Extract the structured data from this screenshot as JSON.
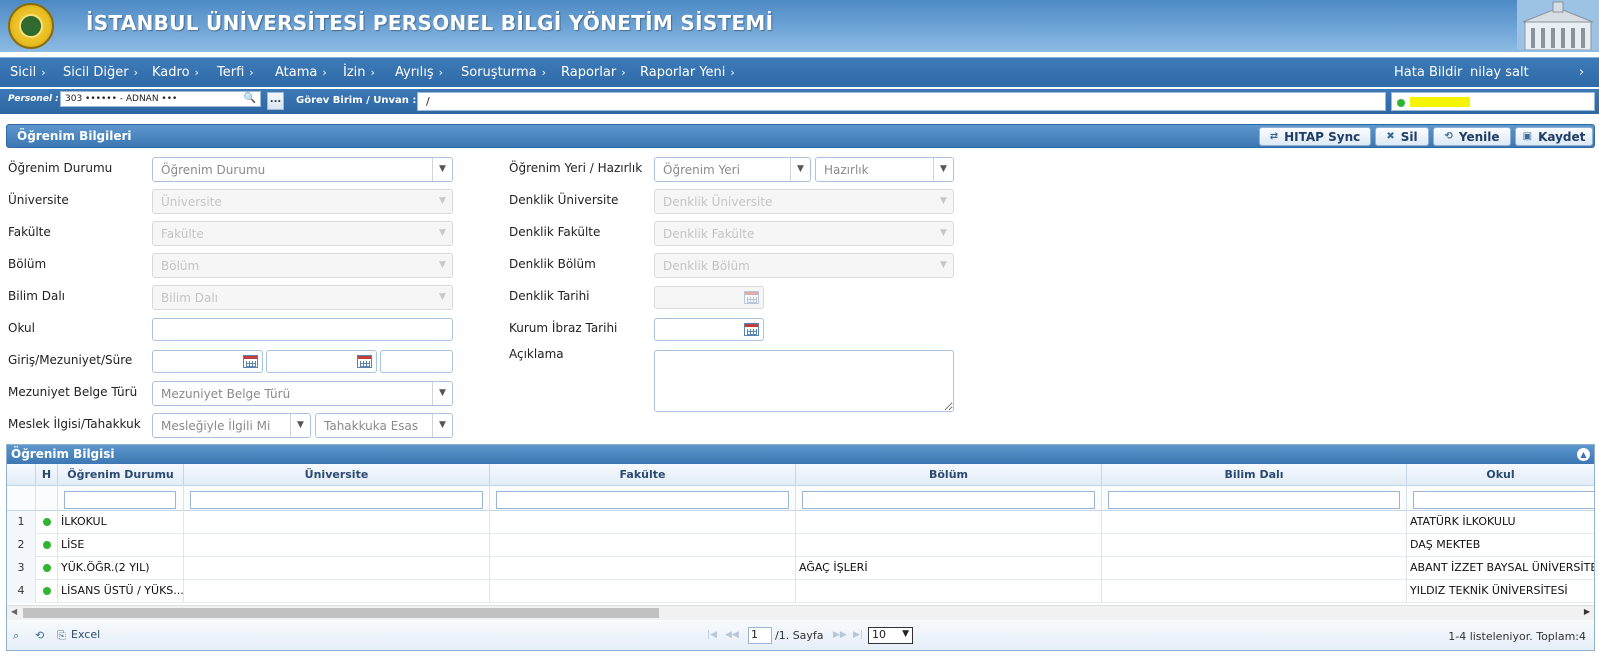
{
  "header": {
    "title": "İSTANBUL ÜNİVERSİTESİ PERSONEL BİLGİ YÖNETİM SİSTEMİ"
  },
  "menu": {
    "items": [
      "Sicil",
      "Sicil Diğer",
      "Kadro",
      "Terfi",
      "Atama",
      "İzin",
      "Ayrılış",
      "Soruşturma",
      "Raporlar",
      "Raporlar Yeni"
    ],
    "report_error": "Hata Bildir",
    "user": "nilay salt"
  },
  "personel_bar": {
    "label": "Personel :",
    "value": "303 ••••••    - ADNAN •••",
    "dots_button": "...",
    "gorev_label": "Görev Birim / Unvan :",
    "gorev_value": "/"
  },
  "section": {
    "title": "Öğrenim Bilgileri",
    "buttons": {
      "hitap": "HITAP Sync",
      "delete": "Sil",
      "refresh": "Yenile",
      "save": "Kaydet"
    }
  },
  "form": {
    "left": {
      "ogrenim_durumu": {
        "label": "Öğrenim Durumu",
        "placeholder": "Öğrenim Durumu"
      },
      "universite": {
        "label": "Üniversite",
        "placeholder": "Üniversite"
      },
      "fakulte": {
        "label": "Fakülte",
        "placeholder": "Fakülte"
      },
      "bolum": {
        "label": "Bölüm",
        "placeholder": "Bölüm"
      },
      "bilim_dali": {
        "label": "Bilim Dalı",
        "placeholder": "Bilim Dalı"
      },
      "okul": {
        "label": "Okul",
        "value": ""
      },
      "giris": {
        "label": "Giriş/Mezuniyet/Süre"
      },
      "mezuniyet_belge": {
        "label": "Mezuniyet Belge Türü",
        "placeholder": "Mezuniyet Belge Türü"
      },
      "meslek": {
        "label": "Meslek İlgisi/Tahakkuk",
        "placeholder1": "Mesleğiyle İlgili Mi",
        "placeholder2": "Tahakkuka Esas"
      }
    },
    "right": {
      "ogrenim_yeri": {
        "label": "Öğrenim Yeri / Hazırlık",
        "placeholder1": "Öğrenim Yeri",
        "placeholder2": "Hazırlık"
      },
      "denklik_universite": {
        "label": "Denklik Üniversite",
        "placeholder": "Denklik Üniversite"
      },
      "denklik_fakulte": {
        "label": "Denklik Fakülte",
        "placeholder": "Denklik Fakülte"
      },
      "denklik_bolum": {
        "label": "Denklik Bölüm",
        "placeholder": "Denklik Bölüm"
      },
      "denklik_tarihi": {
        "label": "Denklik Tarihi"
      },
      "kurum_ibraz": {
        "label": "Kurum İbraz Tarihi"
      },
      "aciklama": {
        "label": "Açıklama"
      }
    }
  },
  "grid": {
    "title": "Öğrenim Bilgisi",
    "columns": [
      "H",
      "Öğrenim Durumu",
      "Üniversite",
      "Fakülte",
      "Bölüm",
      "Bilim Dalı",
      "Okul"
    ],
    "rows": [
      {
        "n": "1",
        "durum": "İLKOKUL",
        "universite": "",
        "fakulte": "",
        "bolum": "",
        "bilim": "",
        "okul": "ATATÜRK İLKOKULU"
      },
      {
        "n": "2",
        "durum": "LİSE",
        "universite": "",
        "fakulte": "",
        "bolum": "",
        "bilim": "",
        "okul": "DAŞ MEKTEB"
      },
      {
        "n": "3",
        "durum": "YÜK.ÖĞR.(2 YIL)",
        "universite": "",
        "fakulte": "",
        "bolum": "AĞAÇ İŞLERİ",
        "bilim": "",
        "okul": "ABANT İZZET BAYSAL ÜNİVERSİTESİ"
      },
      {
        "n": "4",
        "durum": "LİSANS ÜSTÜ / YÜKS...",
        "universite": "",
        "fakulte": "",
        "bolum": "",
        "bilim": "",
        "okul": "YILDIZ TEKNİK ÜNİVERSİTESİ"
      }
    ],
    "pager": {
      "excel": "Excel",
      "page": "1",
      "page_suffix": "/1. Sayfa",
      "page_size": "10",
      "info": "1-4 listeleniyor. Toplam:4"
    }
  },
  "colors": {
    "header_blue": "#4d8bc4",
    "menu_blue": "#2f6aa8",
    "status_green": "#2fb52f",
    "highlight_yellow": "#f5f500"
  }
}
